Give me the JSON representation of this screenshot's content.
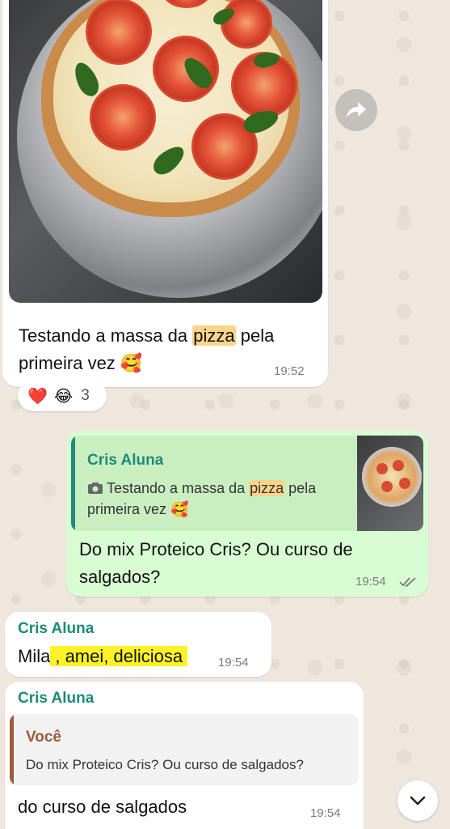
{
  "messages": [
    {
      "text_before": "Testando a massa da ",
      "highlight": "pizza",
      "text_after": " pela",
      "text_line2": "primeira vez 🥰",
      "time": "19:52",
      "reactions": {
        "emojis": [
          "❤️",
          "😂"
        ],
        "count": "3"
      }
    },
    {
      "quote": {
        "name": "Cris Aluna",
        "text_before": "Testando a massa da ",
        "highlight": "pizza",
        "text_after": " pela",
        "text_line2": "primeira vez 🥰",
        "name_color": "#1e8a78",
        "bar_color": "#1e8a78"
      },
      "text_line1": "Do mix Proteico Cris? Ou curso de",
      "text_line2": "salgados?",
      "time": "19:54",
      "status_icon": "✓✓"
    },
    {
      "sender": "Cris Aluna",
      "text_before": "Mila",
      "highlight": ", amei, deliciosa",
      "time": "19:54"
    },
    {
      "sender": "Cris Aluna",
      "quote": {
        "name": "Você",
        "text": "Do mix Proteico Cris? Ou curso de salgados?",
        "name_color": "#9c5b3c",
        "bar_color": "#9c5b3c"
      },
      "text": "do curso de salgados",
      "time": "19:54"
    }
  ],
  "colors": {
    "incoming": "#ffffff",
    "outgoing": "#d9fdd3",
    "sender": "#1e8a78",
    "background": "#efe7de"
  },
  "icons": [
    "forward-icon",
    "camera-icon",
    "double-check-icon",
    "chevron-down-icon"
  ]
}
